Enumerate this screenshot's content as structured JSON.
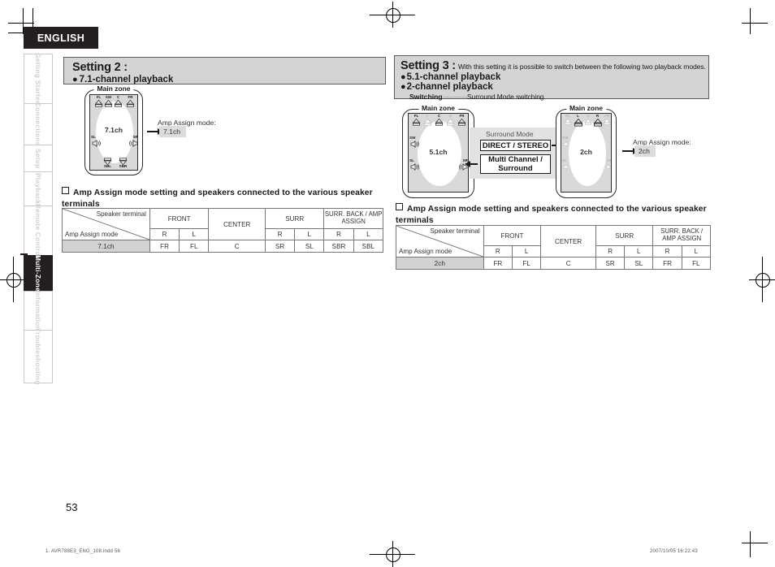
{
  "page": {
    "language_tab": "ENGLISH",
    "page_number": "53",
    "footer_left": "1. AVR788E3_ENG_108.indd   56",
    "footer_right": "2007/10/05   16:22:43"
  },
  "sidebar": {
    "items": [
      {
        "label": "Getting Started",
        "active": false
      },
      {
        "label": "Connections",
        "active": false
      },
      {
        "label": "Setup",
        "active": false
      },
      {
        "label": "Playback",
        "active": false
      },
      {
        "label": "Remote Control",
        "active": false
      },
      {
        "label": "Multi-Zone",
        "active": true
      },
      {
        "label": "Information",
        "active": false
      },
      {
        "label": "Troubleshooting",
        "active": false
      }
    ]
  },
  "setting2": {
    "title": "Setting 2 :",
    "mode_label": "7.1-channel playback",
    "zone_label": "Main zone",
    "channel_text": "7.1ch",
    "amp_caption": "Amp Assign mode:",
    "amp_value": "7.1ch",
    "speakers": [
      {
        "tag": "FL",
        "dim": false
      },
      {
        "tag": "SW",
        "dim": false
      },
      {
        "tag": "C",
        "dim": false
      },
      {
        "tag": "FR",
        "dim": false
      },
      {
        "tag": "SL",
        "dim": false
      },
      {
        "tag": "SR",
        "dim": false
      },
      {
        "tag": "SBL",
        "dim": false
      },
      {
        "tag": "SBR",
        "dim": false
      }
    ],
    "table_heading": "Amp Assign mode setting and speakers connected to the various speaker terminals",
    "table": {
      "corner_top": "Speaker terminal",
      "corner_bottom": "Amp Assign mode",
      "groups": [
        "FRONT",
        "CENTER",
        "SURR",
        "SURR. BACK / AMP ASSIGN"
      ],
      "subheaders": [
        "R",
        "L",
        "",
        "R",
        "L",
        "R",
        "L"
      ],
      "rows": [
        {
          "mode": "7.1ch",
          "values": [
            "FR",
            "FL",
            "C",
            "SR",
            "SL",
            "SBR",
            "SBL"
          ]
        }
      ]
    }
  },
  "setting3": {
    "title": "Setting 3 :",
    "description": "With this setting it is possible to switch between the following two playback modes.",
    "mode_label_1": "5.1-channel playback",
    "mode_label_2": "2-channel playback",
    "switching_label": "Switching",
    "switching_dots": "·················",
    "switching_value": "Surround Mode switching",
    "zone_label_left": "Main zone",
    "zone_label_right": "Main zone",
    "channel_text_left": "5.1ch",
    "channel_text_right": "2ch",
    "surround_mode_title": "Surround Mode",
    "surround_box_top": "DIRECT / STEREO",
    "surround_box_bottom": "Multi Channel /\nSurround",
    "surround_box_bottom_line1": "Multi Channel /",
    "surround_box_bottom_line2": "Surround",
    "amp_caption": "Amp Assign mode:",
    "amp_value": "2ch",
    "speakers_left": [
      {
        "tag": "FL",
        "dim": false
      },
      {
        "tag": "L",
        "dim": true
      },
      {
        "tag": "C",
        "dim": false
      },
      {
        "tag": "R",
        "dim": true
      },
      {
        "tag": "FR",
        "dim": false
      },
      {
        "tag": "SW",
        "dim": false
      },
      {
        "tag": "SL",
        "dim": false
      },
      {
        "tag": "SR",
        "dim": false
      }
    ],
    "speakers_right": [
      {
        "tag": "FL",
        "dim": true
      },
      {
        "tag": "L",
        "dim": false
      },
      {
        "tag": "C",
        "dim": true
      },
      {
        "tag": "R",
        "dim": false
      },
      {
        "tag": "FR",
        "dim": true
      },
      {
        "tag": "SW",
        "dim": true
      },
      {
        "tag": "SL",
        "dim": true
      },
      {
        "tag": "SR",
        "dim": true
      }
    ],
    "table_heading": "Amp Assign mode setting and speakers connected to the various speaker terminals",
    "table": {
      "corner_top": "Speaker terminal",
      "corner_bottom": "Amp Assign mode",
      "groups": [
        "FRONT",
        "CENTER",
        "SURR",
        "SURR. BACK / AMP ASSIGN"
      ],
      "subheaders": [
        "R",
        "L",
        "",
        "R",
        "L",
        "R",
        "L"
      ],
      "rows": [
        {
          "mode": "2ch",
          "values": [
            "FR",
            "FL",
            "C",
            "SR",
            "SL",
            "FR",
            "FL"
          ]
        }
      ]
    }
  }
}
